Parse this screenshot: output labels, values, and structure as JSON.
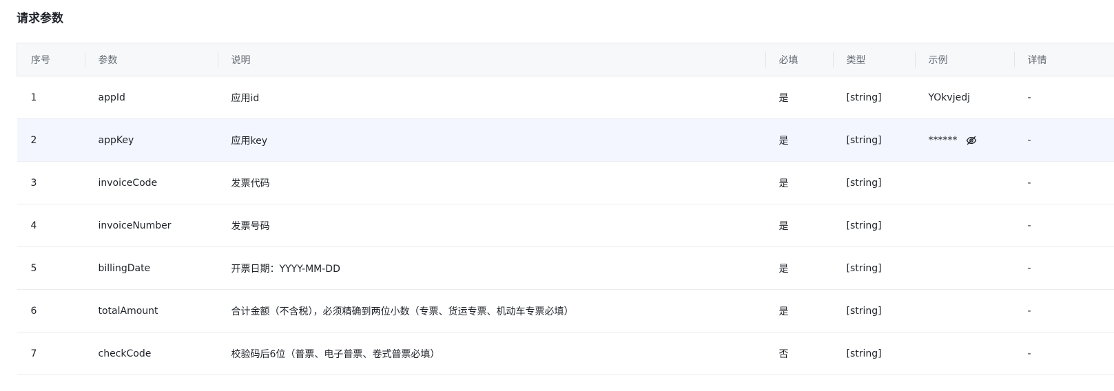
{
  "section": {
    "title": "请求参数"
  },
  "table": {
    "headers": {
      "index": "序号",
      "param": "参数",
      "desc": "说明",
      "required": "必填",
      "type": "类型",
      "example": "示例",
      "detail": "详情"
    },
    "rows": [
      {
        "index": "1",
        "param": "appId",
        "desc": "应用id",
        "required": "是",
        "type": "[string]",
        "example": "YOkvjedj",
        "detail": "-"
      },
      {
        "index": "2",
        "param": "appKey",
        "desc": "应用key",
        "required": "是",
        "type": "[string]",
        "example": "******",
        "detail": "-",
        "example_icon": "eye-off-icon"
      },
      {
        "index": "3",
        "param": "invoiceCode",
        "desc": "发票代码",
        "required": "是",
        "type": "[string]",
        "example": "",
        "detail": "-"
      },
      {
        "index": "4",
        "param": "invoiceNumber",
        "desc": "发票号码",
        "required": "是",
        "type": "[string]",
        "example": "",
        "detail": "-"
      },
      {
        "index": "5",
        "param": "billingDate",
        "desc": "开票日期：YYYY-MM-DD",
        "required": "是",
        "type": "[string]",
        "example": "",
        "detail": "-"
      },
      {
        "index": "6",
        "param": "totalAmount",
        "desc": "合计金额（不含税），必须精确到两位小数（专票、货运专票、机动车专票必填）",
        "required": "是",
        "type": "[string]",
        "example": "",
        "detail": "-"
      },
      {
        "index": "7",
        "param": "checkCode",
        "desc": "校验码后6位（普票、电子普票、卷式普票必填）",
        "required": "否",
        "type": "[string]",
        "example": "",
        "detail": "-"
      }
    ]
  },
  "colors": {
    "header_bg": "#f7f8fa",
    "row_highlight": "#f3f6ff",
    "border": "#ebedf0",
    "header_text": "#646a73",
    "text": "#1f2329"
  }
}
